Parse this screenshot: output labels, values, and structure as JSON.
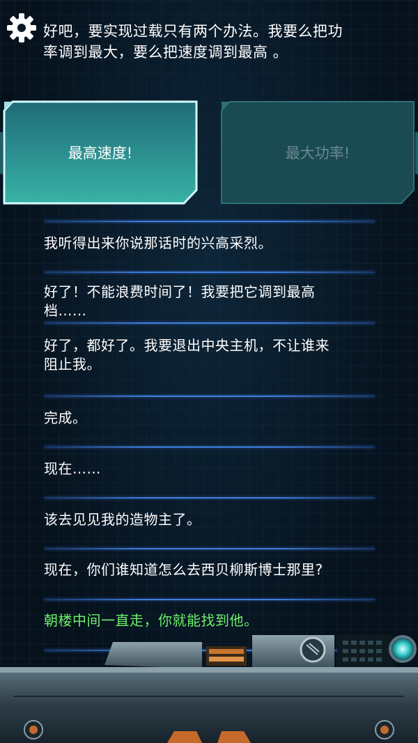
{
  "prompt": {
    "line1": "好吧，要实现过载只有两个办法。我要么把功",
    "line2": "率调到最大，要么把速度调到最高 。"
  },
  "choices": {
    "first": "最高速度!",
    "second": "最大功率!"
  },
  "log": [
    {
      "line1": "我听得出来你说那话时的兴高采烈。",
      "line2": ""
    },
    {
      "line1": "好了！不能浪费时间了！我要把它调到最高",
      "line2": "档……"
    },
    {
      "line1": "好了，都好了。我要退出中央主机，不让谁来",
      "line2": "阻止我。"
    },
    {
      "line1": "完成。",
      "line2": ""
    },
    {
      "line1": "现在……",
      "line2": ""
    },
    {
      "line1": "该去见见我的造物主了。",
      "line2": ""
    },
    {
      "line1": "现在，你们谁知道怎么去西贝柳斯博士那里?",
      "line2": ""
    },
    {
      "line1": "朝楼中间一直走，你就能找到他。",
      "line2": ""
    }
  ],
  "icons": {
    "settings": "gear-icon"
  },
  "colors": {
    "player_reply": "#6df06a",
    "divider": "#3f7fe0",
    "choice_active": "#2a8a92",
    "choice_inactive": "#1a4a52"
  }
}
